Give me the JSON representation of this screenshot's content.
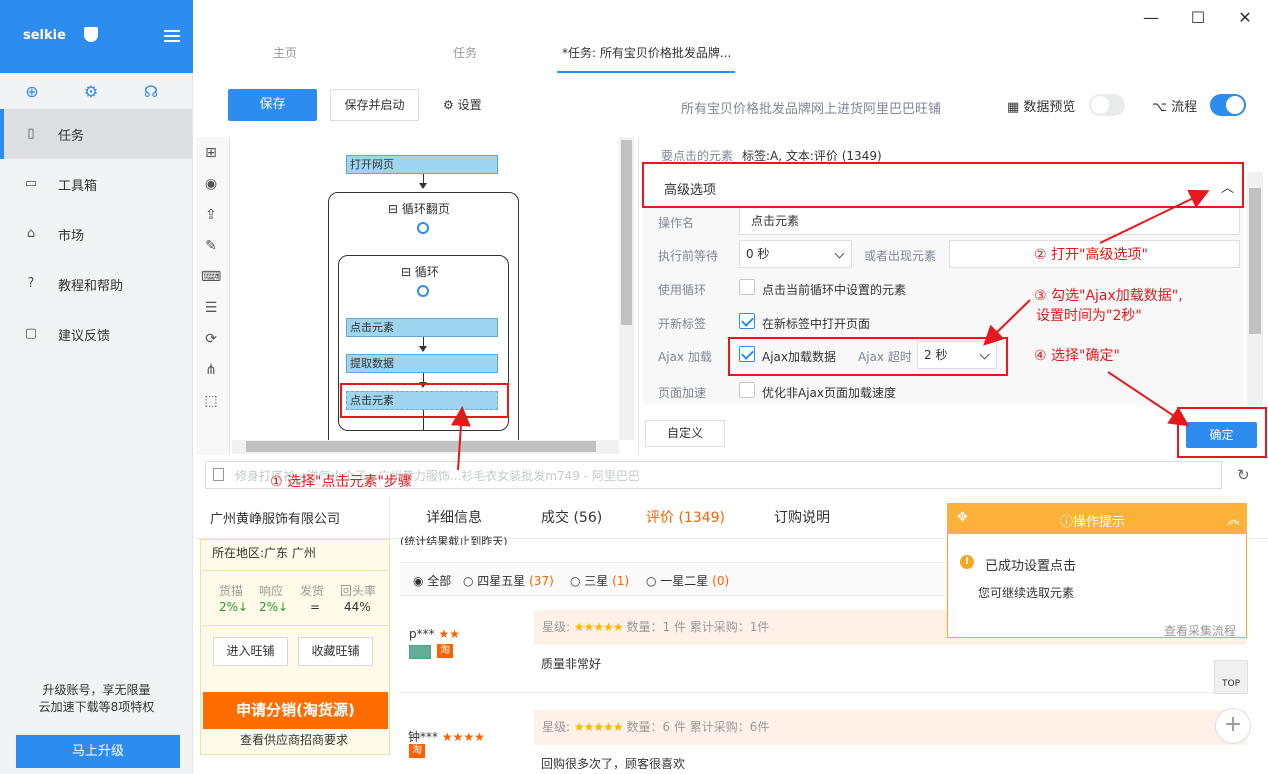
{
  "app": {
    "name": "selkie"
  },
  "sidebar": {
    "items": [
      {
        "label": "任务",
        "icon": "file-icon"
      },
      {
        "label": "工具箱",
        "icon": "toolbox-icon"
      },
      {
        "label": "市场",
        "icon": "bag-icon"
      },
      {
        "label": "教程和帮助",
        "icon": "help-icon"
      },
      {
        "label": "建议反馈",
        "icon": "feedback-icon"
      }
    ],
    "upgrade_line1": "升级账号，享无限量",
    "upgrade_line2": "云加速下载等8项特权",
    "upgrade_button": "马上升级"
  },
  "tabs": [
    "主页",
    "任务",
    "*任务: 所有宝贝价格批发品牌..."
  ],
  "toolbar": {
    "save": "保存",
    "save_run": "保存并启动",
    "settings": "设置",
    "task_title": "所有宝贝价格批发品牌网上进货阿里巴巴旺铺",
    "preview": "数据预览",
    "flow": "流程"
  },
  "flow": {
    "open_page": "打开网页",
    "loop_page": "循环翻页",
    "loop": "循环",
    "click1": "点击元素",
    "extract": "提取数据",
    "click2": "点击元素"
  },
  "panel": {
    "target_label": "要点击的元素",
    "target_value": "标签:A, 文本:评价 (1349)",
    "advanced": "高级选项",
    "op_name_label": "操作名",
    "op_name_value": "点击元素",
    "wait_label": "执行前等待",
    "wait_value": "0 秒",
    "or_appear": "或者出现元素",
    "use_loop_label": "使用循环",
    "use_loop_text": "点击当前循环中设置的元素",
    "new_tab_label": "开新标签",
    "new_tab_text": "在新标签中打开页面",
    "ajax_label": "Ajax 加载",
    "ajax_text": "Ajax加载数据",
    "ajax_timeout_label": "Ajax 超时",
    "ajax_timeout_value": "2 秒",
    "speed_label": "页面加速",
    "speed_text": "优化非Ajax页面加载速度",
    "custom": "自定义",
    "confirm": "确定"
  },
  "annotations": {
    "a1": "① 选择\"点击元素\"步骤",
    "a2": "② 打开\"高级选项\"",
    "a3_line1": "③ 勾选\"Ajax加载数据\",",
    "a3_line2": "设置时间为\"2秒\"",
    "a4": "④ 选择\"确定\""
  },
  "urlbar": {
    "text": "修身打底衫...洋气小个子...广州黄力服饰...衫毛衣女装批发m749 - 阿里巴巴"
  },
  "web": {
    "shop_name": "广州黄峥服饰有限公司",
    "tabs": [
      "详细信息",
      "成交 (56)",
      "评价 (1349)",
      "订购说明"
    ],
    "stat_note": "(统计结果截止到昨天)",
    "region": "所在地区:广东 广州",
    "stats": [
      {
        "label": "货描",
        "value": "2%↓"
      },
      {
        "label": "响应",
        "value": "2%↓"
      },
      {
        "label": "发货",
        "value": "="
      },
      {
        "label": "回头率",
        "value": "44%"
      }
    ],
    "enter_shop": "进入旺铺",
    "fav_shop": "收藏旺铺",
    "apply": "申请分销(淘货源)",
    "view_supply": "查看供应商招商要求",
    "filters": [
      {
        "label": "全部",
        "count": ""
      },
      {
        "label": "四星五星",
        "count": "(37)"
      },
      {
        "label": "三星",
        "count": "(1)"
      },
      {
        "label": "一星二星",
        "count": "(0)"
      }
    ],
    "reviews": [
      {
        "user": "p***",
        "stars_label": "星级:",
        "qty": "数量：1 件",
        "total": "累计采购：1件",
        "text": "质量非常好"
      },
      {
        "user": "钟***",
        "stars_label": "星级:",
        "qty": "数量：6 件",
        "total": "累计采购：6件",
        "text": "回购很多次了，顾客很喜欢"
      }
    ]
  },
  "tip": {
    "title": "操作提示",
    "message": "已成功设置点击",
    "sub": "您可继续选取元素",
    "link": "查看采集流程"
  },
  "colors": {
    "accent": "#2d8cf0",
    "annotation": "#e5191b",
    "warning": "#fbb13a"
  }
}
